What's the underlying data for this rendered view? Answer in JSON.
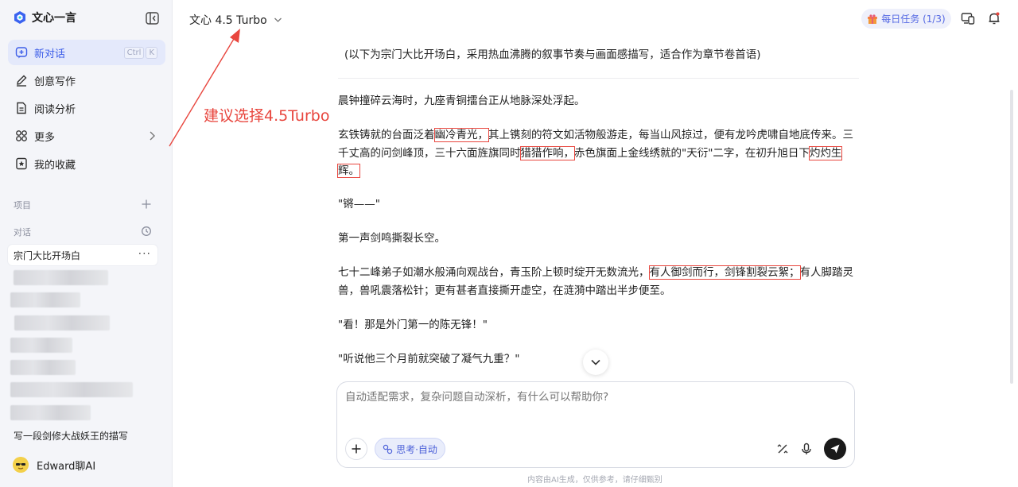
{
  "app": {
    "name": "文心一言"
  },
  "sidebar": {
    "nav": [
      {
        "label": "新对话",
        "shortcut": [
          "Ctrl",
          "K"
        ]
      },
      {
        "label": "创意写作"
      },
      {
        "label": "阅读分析"
      },
      {
        "label": "更多"
      },
      {
        "label": "我的收藏"
      }
    ],
    "projects_label": "项目",
    "chats_label": "对话",
    "chats": [
      {
        "label": "宗门大比开场白"
      },
      {
        "label": "写一段剑修大战妖王的描写"
      }
    ],
    "user": {
      "name": "Edward聊AI"
    }
  },
  "header": {
    "model": "文心 4.5 Turbo",
    "daily_task": "每日任务 (1/3)"
  },
  "annotation": {
    "text": "建议选择4.5Turbo",
    "color": "#e8463e"
  },
  "content": {
    "intro": "(以下为宗门大比开场白，采用热血沸腾的叙事节奏与画面感描写，适合作为章节卷首语)",
    "p1": "晨钟撞碎云海时，九座青铜擂台正从地脉深处浮起。",
    "p2a": "玄铁铸就的台面泛着",
    "p2_h1": "幽冷青光，",
    "p2b": "其上镌刻的符文如活物般游走，每当山风掠过，便有龙吟虎啸自地底传来。三千丈高的问剑峰顶，三十六面旌旗同时",
    "p2_h2": "猎猎作响，",
    "p2c": "赤色旗面上金线绣就的\"天衍\"二字，在初升旭日下",
    "p2_h3": "灼灼生辉。",
    "p3": "\"锵——\"",
    "p4": "第一声剑鸣撕裂长空。",
    "p5a": "七十二峰弟子如潮水般涌向观战台，青玉阶上顿时绽开无数流光，",
    "p5_h1": "有人御剑而行，剑锋割裂云絮；",
    "p5b": "有人脚踏灵兽，兽吼震落松针；更有甚者直接撕开虚空，在涟漪中踏出半步便至。",
    "p6": "\"看！那是外门第一的陈无锋！\"",
    "p7": "\"听说他三个月前就突破了凝气九重？\""
  },
  "input": {
    "placeholder": "自动适配需求，复杂问题自动深析，有什么可以帮助你?",
    "think_label": "思考·自动"
  },
  "footer": {
    "note": "内容由AI生成，仅供参考，请仔细甄别"
  },
  "colors": {
    "accent": "#3c5de8",
    "highlight": "#e8463e"
  }
}
